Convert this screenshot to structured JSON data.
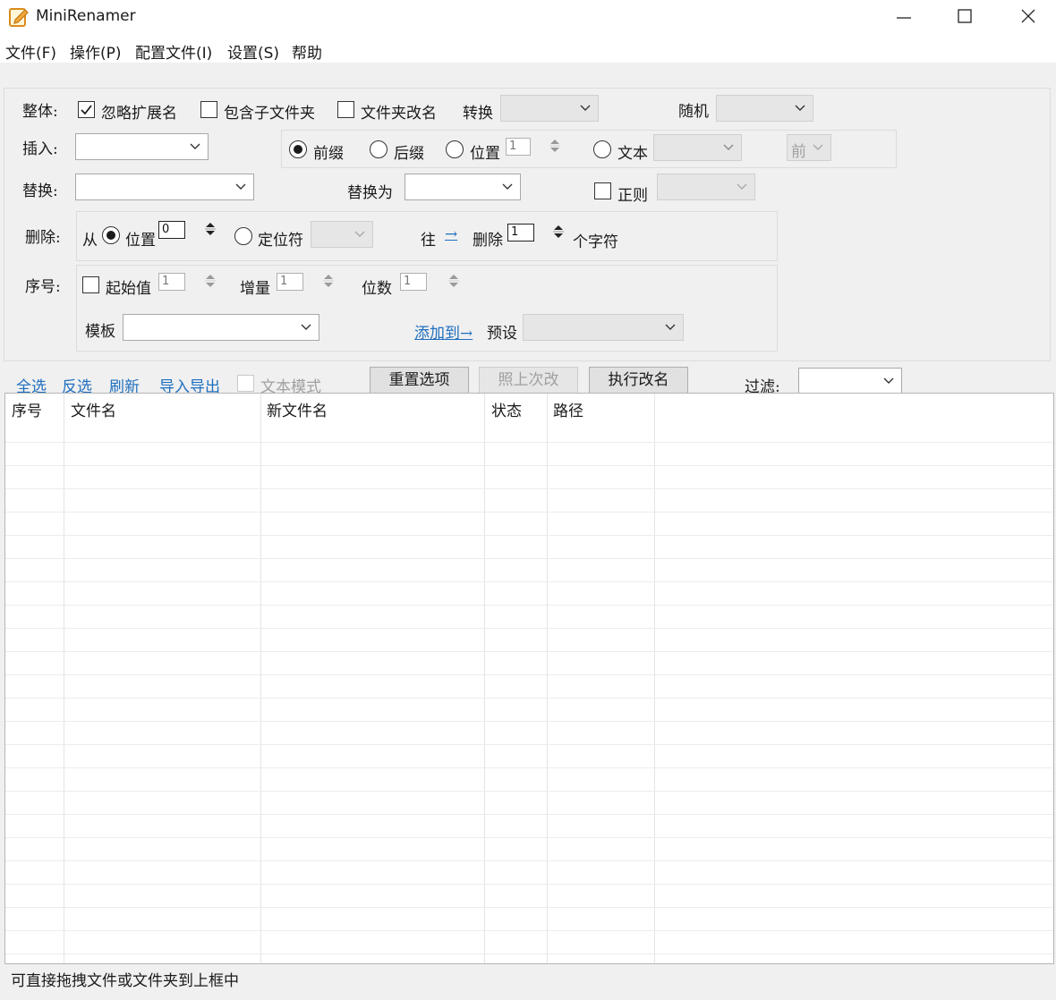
{
  "window": {
    "title": "MiniRenamer",
    "app_icon": "notepad-pencil-icon"
  },
  "menu": [
    "文件(F)",
    "操作(P)",
    "配置文件(I)",
    "设置(S)",
    "帮助"
  ],
  "overall": {
    "label": "整体:",
    "ignore_ext": "忽略扩展名",
    "include_subfolders": "包含子文件夹",
    "rename_folders": "文件夹改名",
    "convert_label": "转换",
    "random_label": "随机"
  },
  "insert": {
    "label": "插入:",
    "prefix": "前缀",
    "suffix": "后缀",
    "position": "位置",
    "position_value": "1",
    "text": "文本",
    "front": "前"
  },
  "replace": {
    "label": "替换:",
    "with_label": "替换为",
    "regex": "正则"
  },
  "delete": {
    "label": "删除:",
    "from": "从",
    "position": "位置",
    "position_value": "0",
    "locator": "定位符",
    "toward": "往",
    "arrow": "→",
    "delete_word": "删除",
    "count_value": "1",
    "chars": "个字符"
  },
  "sequence": {
    "label": "序号:",
    "start": "起始值",
    "start_value": "1",
    "increment": "增量",
    "increment_value": "1",
    "digits": "位数",
    "digits_value": "1",
    "template": "模板",
    "add_to": "添加到→",
    "preset": "预设"
  },
  "toolbar": {
    "select_all": "全选",
    "invert": "反选",
    "refresh": "刷新",
    "import_export": "导入导出",
    "text_mode": "文本模式",
    "reset": "重置选项",
    "redo_last": "照上次改",
    "execute": "执行改名",
    "filter": "过滤:"
  },
  "table": {
    "columns": [
      "序号",
      "文件名",
      "新文件名",
      "状态",
      "路径"
    ]
  },
  "status_bar": "可直接拖拽文件或文件夹到上框中"
}
